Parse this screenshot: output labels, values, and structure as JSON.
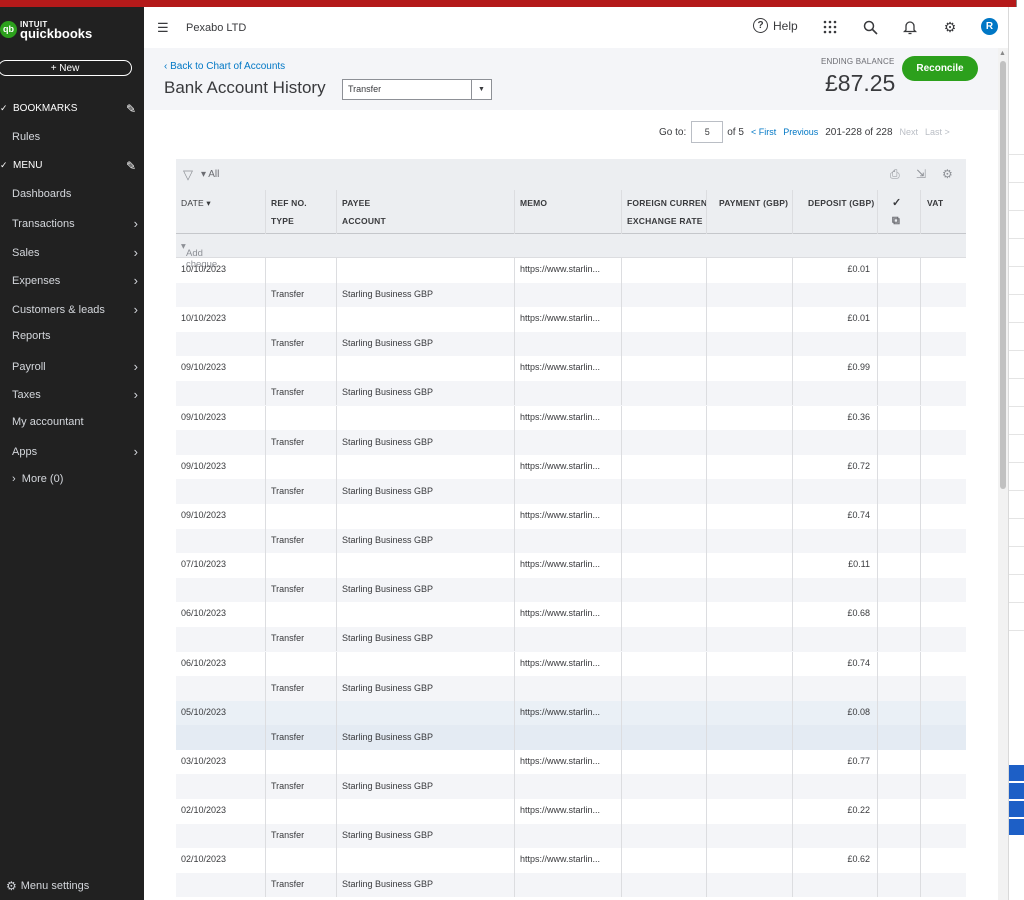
{
  "app": {
    "logo_brand": "INTUIT",
    "logo_product": "quickbooks",
    "company": "Pexabo LTD",
    "avatar_letter": "R"
  },
  "sidebar": {
    "new_label": "+ New",
    "bookmarks_label": "BOOKMARKS",
    "rules_label": "Rules",
    "menu_label": "MENU",
    "items": [
      {
        "label": "Dashboards",
        "has_arrow": false
      },
      {
        "label": "Transactions",
        "has_arrow": true
      },
      {
        "label": "Sales",
        "has_arrow": true
      },
      {
        "label": "Expenses",
        "has_arrow": true
      },
      {
        "label": "Customers & leads",
        "has_arrow": true
      },
      {
        "label": "Reports",
        "has_arrow": false
      },
      {
        "label": "Payroll",
        "has_arrow": true
      },
      {
        "label": "Taxes",
        "has_arrow": true
      },
      {
        "label": "My accountant",
        "has_arrow": false
      },
      {
        "label": "Apps",
        "has_arrow": true
      }
    ],
    "more_label": "More (0)",
    "menu_settings_label": "Menu settings"
  },
  "header": {
    "help_label": "Help",
    "icons": [
      "apps-grid-icon",
      "search-icon",
      "bell-icon",
      "gear-icon"
    ]
  },
  "page": {
    "back_link": "Back to Chart of Accounts",
    "title": "Bank Account History",
    "account_selected": "Transfer",
    "ending_balance_label": "ENDING BALANCE",
    "ending_balance_value": "£87.25",
    "reconcile_label": "Reconcile"
  },
  "pager": {
    "goto_label": "Go to:",
    "goto_value": "5",
    "of_label": "of 5",
    "first_label": "< First",
    "previous_label": "Previous",
    "range_label": "201-228 of 228",
    "next_label": "Next",
    "last_label": "Last >"
  },
  "table": {
    "filter_label": "All",
    "columns": {
      "date": "DATE ▾",
      "ref_no": "REF NO.",
      "type": "TYPE",
      "payee": "PAYEE",
      "account": "ACCOUNT",
      "memo": "MEMO",
      "foreign_currency": "FOREIGN CURRENC",
      "exchange_rate": "EXCHANGE RATE",
      "payment": "PAYMENT (GBP)",
      "deposit": "DEPOSIT (GBP)",
      "check": "✓",
      "vat": "VAT"
    },
    "add_label": "Add cheque",
    "rows": [
      {
        "date": "10/10/2023",
        "memo": "https://www.starlin...",
        "deposit": "£0.01",
        "type": "Transfer",
        "account": "Starling Business GBP",
        "highlight": false
      },
      {
        "date": "10/10/2023",
        "memo": "https://www.starlin...",
        "deposit": "£0.01",
        "type": "Transfer",
        "account": "Starling Business GBP",
        "highlight": false
      },
      {
        "date": "09/10/2023",
        "memo": "https://www.starlin...",
        "deposit": "£0.99",
        "type": "Transfer",
        "account": "Starling Business GBP",
        "highlight": false
      },
      {
        "date": "09/10/2023",
        "memo": "https://www.starlin...",
        "deposit": "£0.36",
        "type": "Transfer",
        "account": "Starling Business GBP",
        "highlight": false
      },
      {
        "date": "09/10/2023",
        "memo": "https://www.starlin...",
        "deposit": "£0.72",
        "type": "Transfer",
        "account": "Starling Business GBP",
        "highlight": false
      },
      {
        "date": "09/10/2023",
        "memo": "https://www.starlin...",
        "deposit": "£0.74",
        "type": "Transfer",
        "account": "Starling Business GBP",
        "highlight": false
      },
      {
        "date": "07/10/2023",
        "memo": "https://www.starlin...",
        "deposit": "£0.11",
        "type": "Transfer",
        "account": "Starling Business GBP",
        "highlight": false
      },
      {
        "date": "06/10/2023",
        "memo": "https://www.starlin...",
        "deposit": "£0.68",
        "type": "Transfer",
        "account": "Starling Business GBP",
        "highlight": false
      },
      {
        "date": "06/10/2023",
        "memo": "https://www.starlin...",
        "deposit": "£0.74",
        "type": "Transfer",
        "account": "Starling Business GBP",
        "highlight": false
      },
      {
        "date": "05/10/2023",
        "memo": "https://www.starlin...",
        "deposit": "£0.08",
        "type": "Transfer",
        "account": "Starling Business GBP",
        "highlight": true
      },
      {
        "date": "03/10/2023",
        "memo": "https://www.starlin...",
        "deposit": "£0.77",
        "type": "Transfer",
        "account": "Starling Business GBP",
        "highlight": false
      },
      {
        "date": "02/10/2023",
        "memo": "https://www.starlin...",
        "deposit": "£0.22",
        "type": "Transfer",
        "account": "Starling Business GBP",
        "highlight": false
      },
      {
        "date": "02/10/2023",
        "memo": "https://www.starlin...",
        "deposit": "£0.62",
        "type": "Transfer",
        "account": "Starling Business GBP",
        "highlight": false
      }
    ]
  },
  "colors": {
    "sidebar_bg": "#212121",
    "accent_green": "#2ca01c",
    "link_blue": "#0077c5",
    "top_stripe": "#b41a1a"
  }
}
